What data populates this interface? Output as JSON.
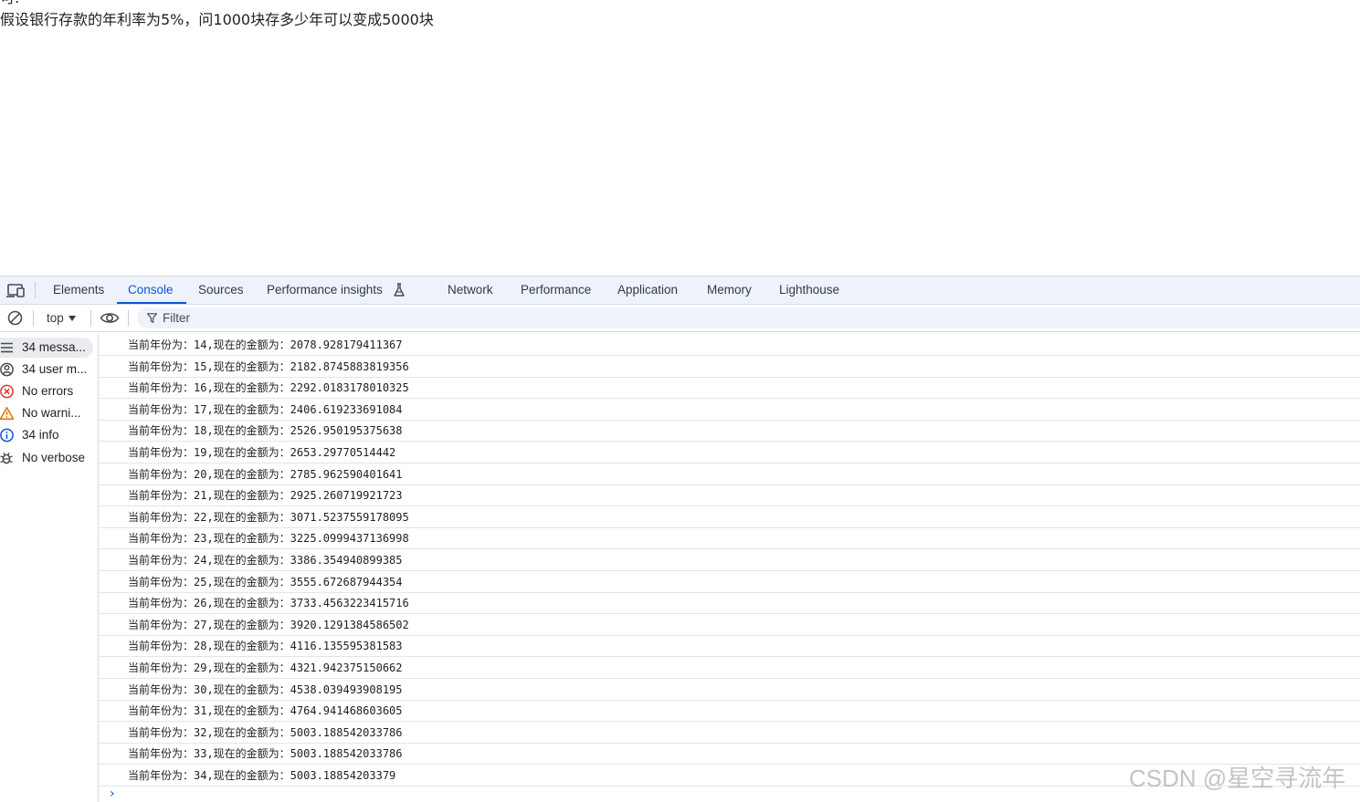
{
  "page": {
    "cut_line": "可:",
    "question": "假设银行存款的年利率为5%，问1000块存多少年可以变成5000块"
  },
  "devtools": {
    "tabs": [
      {
        "label": "Elements"
      },
      {
        "label": "Console",
        "active": true
      },
      {
        "label": "Sources"
      },
      {
        "label": "Performance insights"
      },
      {
        "label": "Network"
      },
      {
        "label": "Performance"
      },
      {
        "label": "Application"
      },
      {
        "label": "Memory"
      },
      {
        "label": "Lighthouse"
      }
    ],
    "toolbar": {
      "context": "top",
      "filter_placeholder": "Filter"
    },
    "sidebar": [
      {
        "label": "34 messa...",
        "icon": "list-icon",
        "selected": true
      },
      {
        "label": "34 user m...",
        "icon": "user-icon"
      },
      {
        "label": "No errors",
        "icon": "error-icon"
      },
      {
        "label": "No warni...",
        "icon": "warning-icon"
      },
      {
        "label": "34 info",
        "icon": "info-icon"
      },
      {
        "label": "No verbose",
        "icon": "bug-icon"
      }
    ],
    "log": [
      "当前年份为：14,现在的金额为：2078.928179411367",
      "当前年份为：15,现在的金额为：2182.8745883819356",
      "当前年份为：16,现在的金额为：2292.0183178010325",
      "当前年份为：17,现在的金额为：2406.619233691084",
      "当前年份为：18,现在的金额为：2526.950195375638",
      "当前年份为：19,现在的金额为：2653.29770514442",
      "当前年份为：20,现在的金额为：2785.962590401641",
      "当前年份为：21,现在的金额为：2925.260719921723",
      "当前年份为：22,现在的金额为：3071.5237559178095",
      "当前年份为：23,现在的金额为：3225.0999437136998",
      "当前年份为：24,现在的金额为：3386.354940899385",
      "当前年份为：25,现在的金额为：3555.672687944354",
      "当前年份为：26,现在的金额为：3733.4563223415716",
      "当前年份为：27,现在的金额为：3920.1291384586502",
      "当前年份为：28,现在的金额为：4116.135595381583",
      "当前年份为：29,现在的金额为：4321.942375150662",
      "当前年份为：30,现在的金额为：4538.039493908195",
      "当前年份为：31,现在的金额为：4764.941468603605",
      "当前年份为：32,现在的金额为：5003.188542033786",
      "当前年份为：33,现在的金额为：5003.188542033786",
      "当前年份为：34,现在的金额为：5003.18854203379"
    ],
    "prompt": "›"
  },
  "watermark": "CSDN @星空寻流年",
  "colors": {
    "accent": "#0b57d0",
    "tabbar_bg": "#eef3fb",
    "error": "#dc362e",
    "warning": "#e37400",
    "info": "#0b57d0"
  }
}
